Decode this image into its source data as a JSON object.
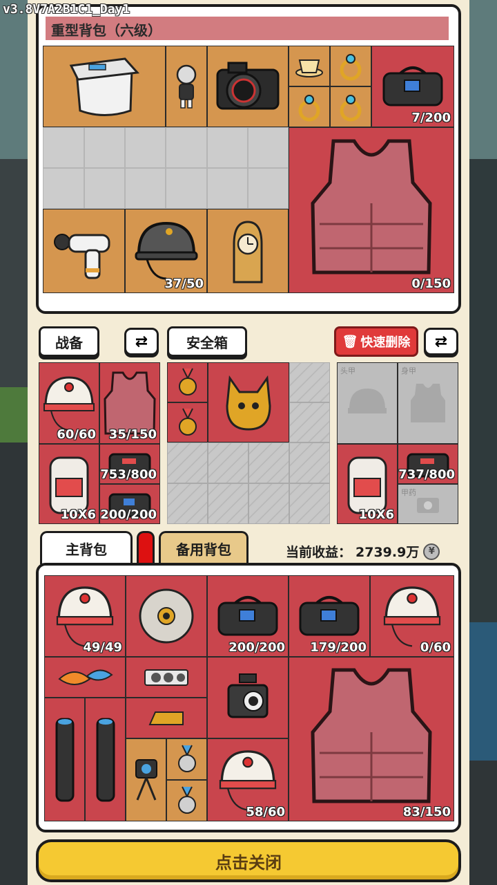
{
  "version": "v3.8V7A2B1C1_Day1",
  "backpack": {
    "title": "重型背包（六级）",
    "counts": {
      "bag": "7/200",
      "helmet": "37/50",
      "vest": "0/150"
    }
  },
  "tabs": {
    "gear": "战备",
    "safe_box": "安全箱",
    "quick_delete": "快速删除"
  },
  "gear": {
    "helmet_count": "60/60",
    "vest_count": "35/150",
    "backpack_size": "10X6",
    "bag_count": "753/800",
    "bag2_count": "200/200"
  },
  "equip": {
    "head_label": "头甲",
    "body_label": "身甲",
    "backpack_size": "10X6",
    "bag_count": "737/800",
    "medkit_label": "甲药"
  },
  "main_tabs": {
    "main": "主背包",
    "spare": "备用背包"
  },
  "income": {
    "label": "当前收益：",
    "value": "2739.9万"
  },
  "main_bag": {
    "helmet1": "49/49",
    "bag1": "200/200",
    "bag2": "179/200",
    "helmet2": "0/60",
    "helmet3": "58/60",
    "vest": "83/150"
  },
  "close_label": "点击关闭",
  "colors": {
    "rare_red": "#c9454d",
    "epic_orange": "#d5964f",
    "button_yellow": "#f5c932",
    "delete_red": "#e03a3a"
  }
}
